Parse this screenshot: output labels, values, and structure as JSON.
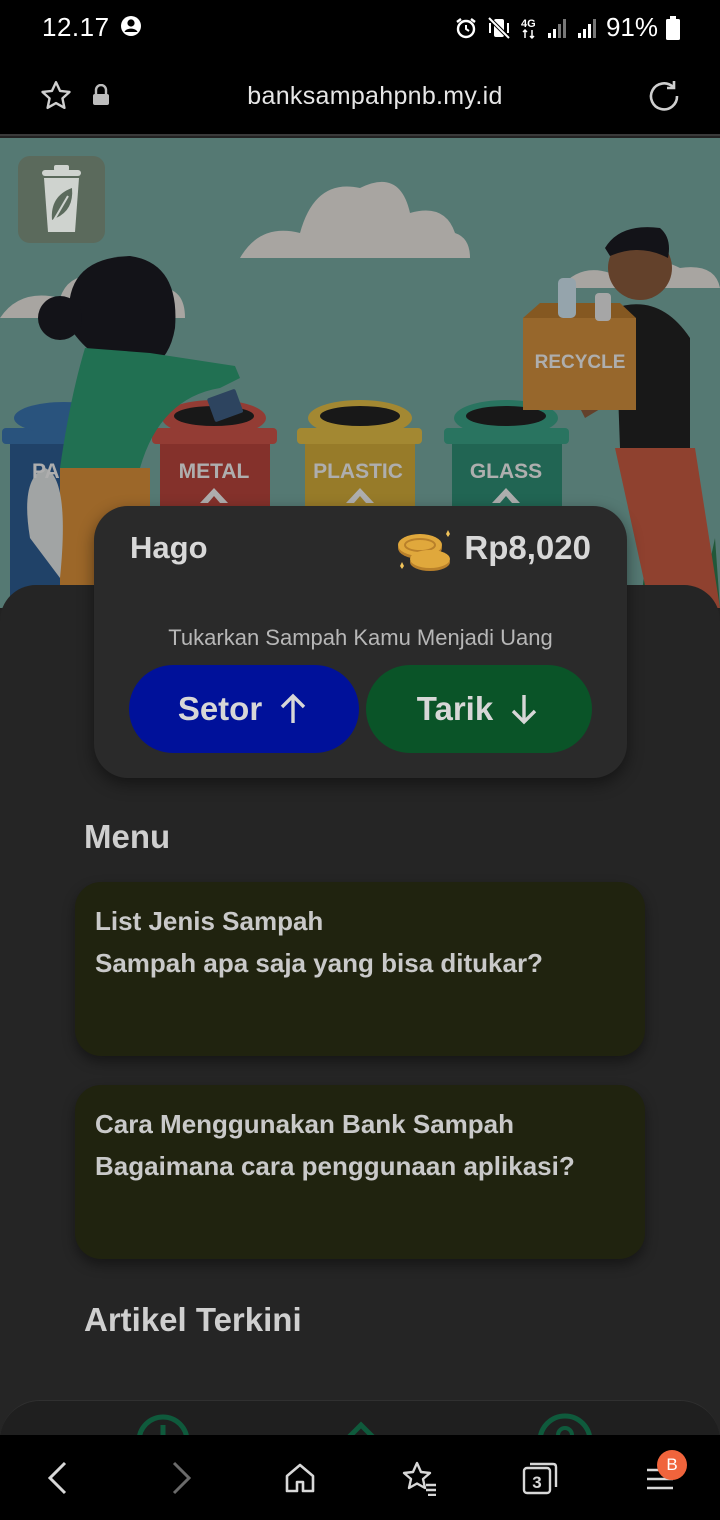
{
  "status_bar": {
    "time": "12.17",
    "battery": "91%",
    "icons": [
      "user-circle-icon",
      "alarm-icon",
      "mute-vibrate-icon",
      "4g-icon",
      "signal-icon",
      "signal-icon",
      "battery-icon"
    ]
  },
  "url_bar": {
    "url": "banksampahpnb.my.id",
    "icons": [
      "star-icon",
      "lock-icon",
      "reload-icon"
    ]
  },
  "hero": {
    "bins": [
      "PA",
      "METAL",
      "PLASTIC",
      "GLASS"
    ],
    "box_label": "RECYCLE"
  },
  "balance_card": {
    "user_name": "Hago",
    "balance": "Rp8,020",
    "tagline": "Tukarkan Sampah Kamu Menjadi Uang",
    "setor_label": "Setor",
    "tarik_label": "Tarik",
    "colors": {
      "setor": "#00119a",
      "tarik": "#0a5428"
    }
  },
  "menu": {
    "title": "Menu",
    "items": [
      {
        "title": "List Jenis Sampah",
        "subtitle": "Sampah apa saja yang bisa ditukar?"
      },
      {
        "title": "Cara Menggunakan Bank Sampah",
        "subtitle": "Bagaimana cara penggunaan aplikasi?"
      }
    ]
  },
  "articles": {
    "title": "Artikel Terkini"
  },
  "browser_bar": {
    "tabs_count": "3",
    "badge": "B",
    "icons": [
      "back-icon",
      "forward-icon",
      "home-icon",
      "bookmarks-icon",
      "tabs-icon",
      "menu-icon"
    ]
  }
}
